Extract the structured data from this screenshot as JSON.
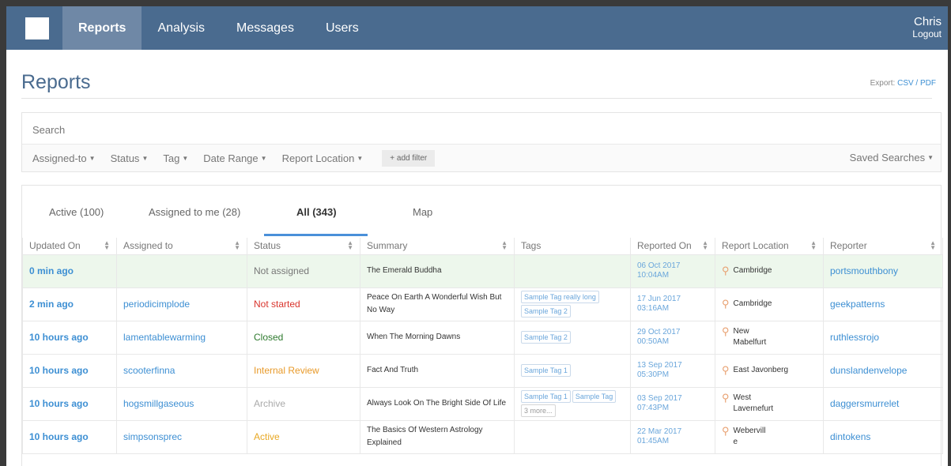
{
  "nav": {
    "items": [
      {
        "label": "Reports",
        "active": true
      },
      {
        "label": "Analysis",
        "active": false
      },
      {
        "label": "Messages",
        "active": false
      },
      {
        "label": "Users",
        "active": false
      }
    ],
    "user_name": "Chris",
    "logout_label": "Logout"
  },
  "header": {
    "title": "Reports",
    "export_label": "Export: ",
    "export_csv": "CSV",
    "export_sep": " / ",
    "export_pdf": "PDF"
  },
  "search": {
    "placeholder": "Search",
    "filters": [
      "Assigned-to",
      "Status",
      "Tag",
      "Date Range",
      "Report Location"
    ],
    "add_filter_label": "+ add filter",
    "saved_searches_label": "Saved Searches"
  },
  "tabs": [
    {
      "label": "Active (100)",
      "active": false
    },
    {
      "label": "Assigned to me (28)",
      "active": false
    },
    {
      "label": "All (343)",
      "active": true
    },
    {
      "label": "Map",
      "active": false
    }
  ],
  "table": {
    "columns": [
      "Updated On",
      "Assigned to",
      "Status",
      "Summary",
      "Tags",
      "Reported On",
      "Report Location",
      "Reporter"
    ],
    "rows": [
      {
        "updated": "0 min ago",
        "assignee": "",
        "status": "Not assigned",
        "status_kind": "notassigned",
        "summary": "The Emerald Buddha",
        "tags": [],
        "reported_date": "06 Oct 2017",
        "reported_time": "10:04AM",
        "location_1": "Cambridge",
        "location_2": "",
        "reporter": "portsmouthbony",
        "highlight": true
      },
      {
        "updated": "2 min ago",
        "assignee": "periodicimplode",
        "status": "Not started",
        "status_kind": "notstarted",
        "summary": "Peace On Earth A Wonderful Wish But No Way",
        "tags": [
          "Sample Tag really long",
          "Sample Tag 2"
        ],
        "reported_date": "17 Jun 2017",
        "reported_time": "03:16AM",
        "location_1": "Cambridge",
        "location_2": "",
        "reporter": "geekpatterns",
        "highlight": false
      },
      {
        "updated": "10 hours ago",
        "assignee": "lamentablewarming",
        "status": "Closed",
        "status_kind": "closed",
        "summary": "When The Morning Dawns",
        "tags": [
          "Sample Tag 2"
        ],
        "reported_date": "29 Oct 2017",
        "reported_time": "00:50AM",
        "location_1": "New",
        "location_2": "Mabelfurt",
        "reporter": "ruthlessrojo",
        "highlight": false
      },
      {
        "updated": "10 hours ago",
        "assignee": "scooterfinna",
        "status": "Internal Review",
        "status_kind": "review",
        "summary": "Fact And Truth",
        "tags": [
          "Sample Tag 1"
        ],
        "reported_date": "13 Sep 2017",
        "reported_time": "05:30PM",
        "location_1": "East Javonberg",
        "location_2": "",
        "reporter": "dunslandenvelope",
        "highlight": false
      },
      {
        "updated": "10 hours ago",
        "assignee": "hogsmillgaseous",
        "status": "Archive",
        "status_kind": "archive",
        "summary": "Always Look On The Bright Side Of Life",
        "tags": [
          "Sample Tag 1",
          "Sample Tag",
          "3 more..."
        ],
        "reported_date": "03 Sep 2017",
        "reported_time": "07:43PM",
        "location_1": "West",
        "location_2": "Lavernefurt",
        "reporter": "daggersmurrelet",
        "highlight": false
      },
      {
        "updated": "10 hours ago",
        "assignee": "simpsonsprec",
        "status": "Active",
        "status_kind": "active",
        "summary": "The Basics Of Western Astrology Explained",
        "tags": [],
        "reported_date": "22 Mar 2017",
        "reported_time": "01:45AM",
        "location_1": "Webervill",
        "location_2": "e",
        "reporter": "dintokens",
        "highlight": false
      }
    ]
  },
  "colors": {
    "nav_bg": "#4a6b8f",
    "nav_active_bg": "#6f88a6",
    "link_blue": "#3d8fd3",
    "highlight_row": "#edf7ec"
  },
  "icons": {
    "location": "map-pin-icon",
    "caret": "caret-down-icon",
    "sort": "sort-icon"
  }
}
